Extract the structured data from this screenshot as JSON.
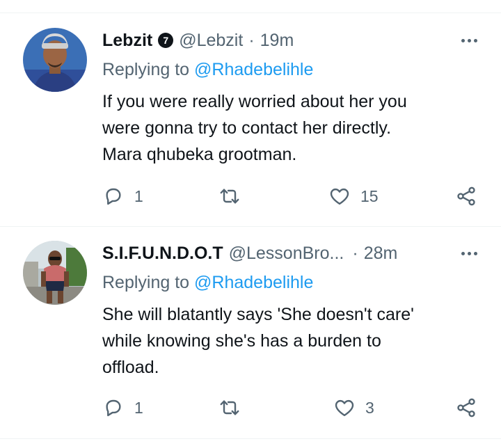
{
  "tweets": [
    {
      "name": "Lebzit",
      "badge": "7",
      "handle": "@Lebzit",
      "separator": "·",
      "time": "19m",
      "replying_label": "Replying to",
      "replying_handle": "@Rhadebelihle",
      "text_lines": [
        "If you were really worried about her you",
        "were gonna try to contact her directly.",
        "Mara qhubeka grootman."
      ],
      "reply_count": "1",
      "retweet_count": "",
      "like_count": "15"
    },
    {
      "name": "S.I.F.U.N.D.O.T",
      "badge": "",
      "handle": "@LessonBro...",
      "separator": "·",
      "time": "28m",
      "replying_label": "Replying to",
      "replying_handle": "@Rhadebelihle",
      "text_lines": [
        "She will blatantly says 'She doesn't care'",
        "while knowing she's has a burden to",
        "offload."
      ],
      "reply_count": "1",
      "retweet_count": "",
      "like_count": "3"
    }
  ],
  "icons": {
    "reply": "reply-icon",
    "retweet": "retweet-icon",
    "like": "like-icon",
    "share": "share-icon",
    "more": "more-icon",
    "badge": "badge-icon"
  },
  "colors": {
    "text": "#0f1419",
    "secondary": "#536471",
    "link": "#1d9bf0",
    "divider": "#eff3f4"
  }
}
